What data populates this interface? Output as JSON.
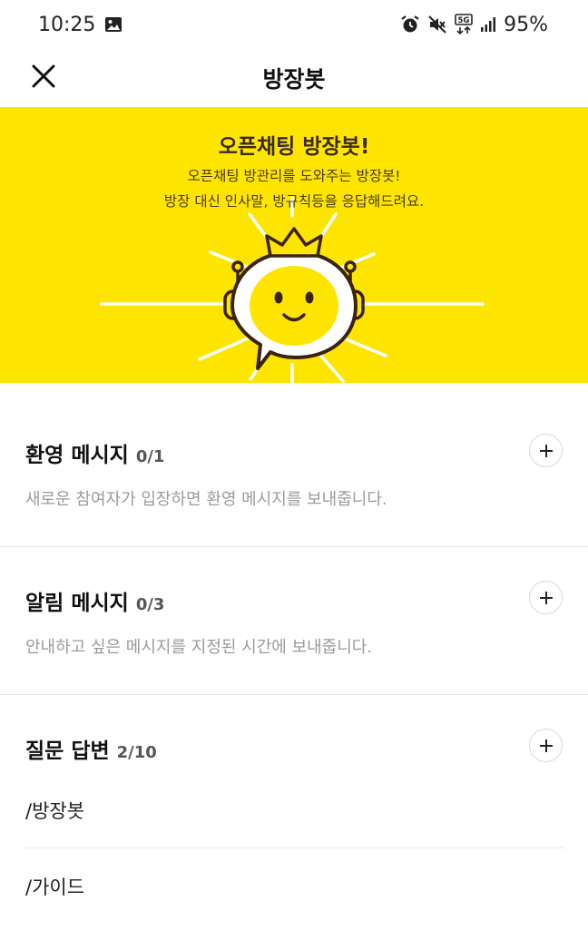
{
  "status_bar": {
    "time": "10:25",
    "battery": "95%",
    "network": "5G"
  },
  "app_bar": {
    "title": "방장봇"
  },
  "banner": {
    "title": "오픈채팅 방장봇!",
    "desc_line1": "오픈채팅 방관리를 도와주는 방장봇!",
    "desc_line2": "방장 대신 인사말, 방규칙등을 응답해드려요.",
    "background": "#FEE500"
  },
  "sections": {
    "welcome": {
      "title": "환영 메시지",
      "count": "0/1",
      "desc": "새로운 참여자가 입장하면 환영 메시지를 보내줍니다."
    },
    "notice": {
      "title": "알림 메시지",
      "count": "0/3",
      "desc": "안내하고 싶은 메시지를 지정된 시간에 보내줍니다."
    },
    "qa": {
      "title": "질문 답변",
      "count": "2/10",
      "items": [
        "/방장봇",
        "/가이드"
      ]
    }
  },
  "icons": {
    "close": "close-icon",
    "add": "plus-icon",
    "gallery": "image-icon",
    "alarm": "alarm-icon",
    "mute": "vibrate-mute-icon",
    "signal": "signal-icon"
  }
}
